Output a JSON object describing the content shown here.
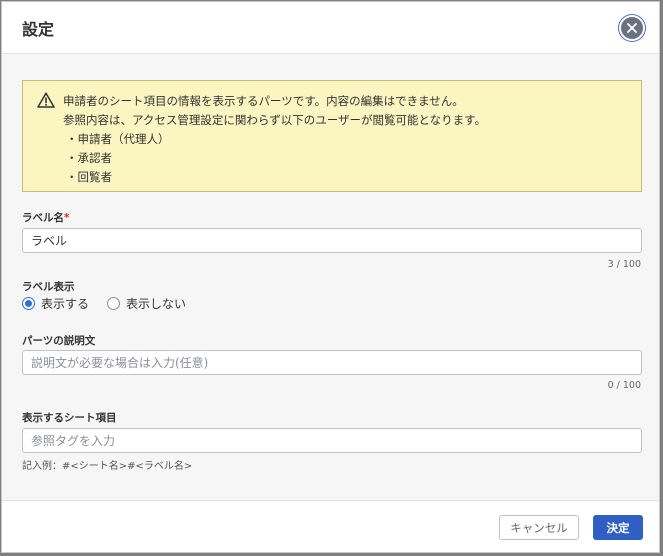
{
  "dialog": {
    "title": "設定"
  },
  "alert": {
    "lines": [
      "申請者のシート項目の情報を表示するパーツです。内容の編集はできません。",
      "参照内容は、アクセス管理設定に関わらず以下のユーザーが閲覧可能となります。"
    ],
    "items": [
      "・申請者（代理人）",
      "・承認者",
      "・回覧者"
    ]
  },
  "label_field": {
    "label": "ラベル名",
    "required_mark": "*",
    "value": "ラベル",
    "counter": "3 / 100"
  },
  "label_display": {
    "label": "ラベル表示",
    "options": [
      "表示する",
      "表示しない"
    ],
    "selected": "表示する"
  },
  "description_field": {
    "label": "パーツの説明文",
    "placeholder": "説明文が必要な場合は入力(任意)",
    "counter": "0 / 100"
  },
  "sheet_item_field": {
    "label": "表示するシート項目",
    "placeholder": "参照タグを入力",
    "hint": "記入例：#<シート名>#<ラベル名>"
  },
  "footer": {
    "cancel_label": "キャンセル",
    "ok_label": "決定"
  },
  "colors": {
    "primary": "#2f5fc2",
    "alert_bg": "#fbf5c2",
    "required": "#d12b2b"
  },
  "icons": {
    "close": "close-icon",
    "warning": "warning-icon"
  }
}
